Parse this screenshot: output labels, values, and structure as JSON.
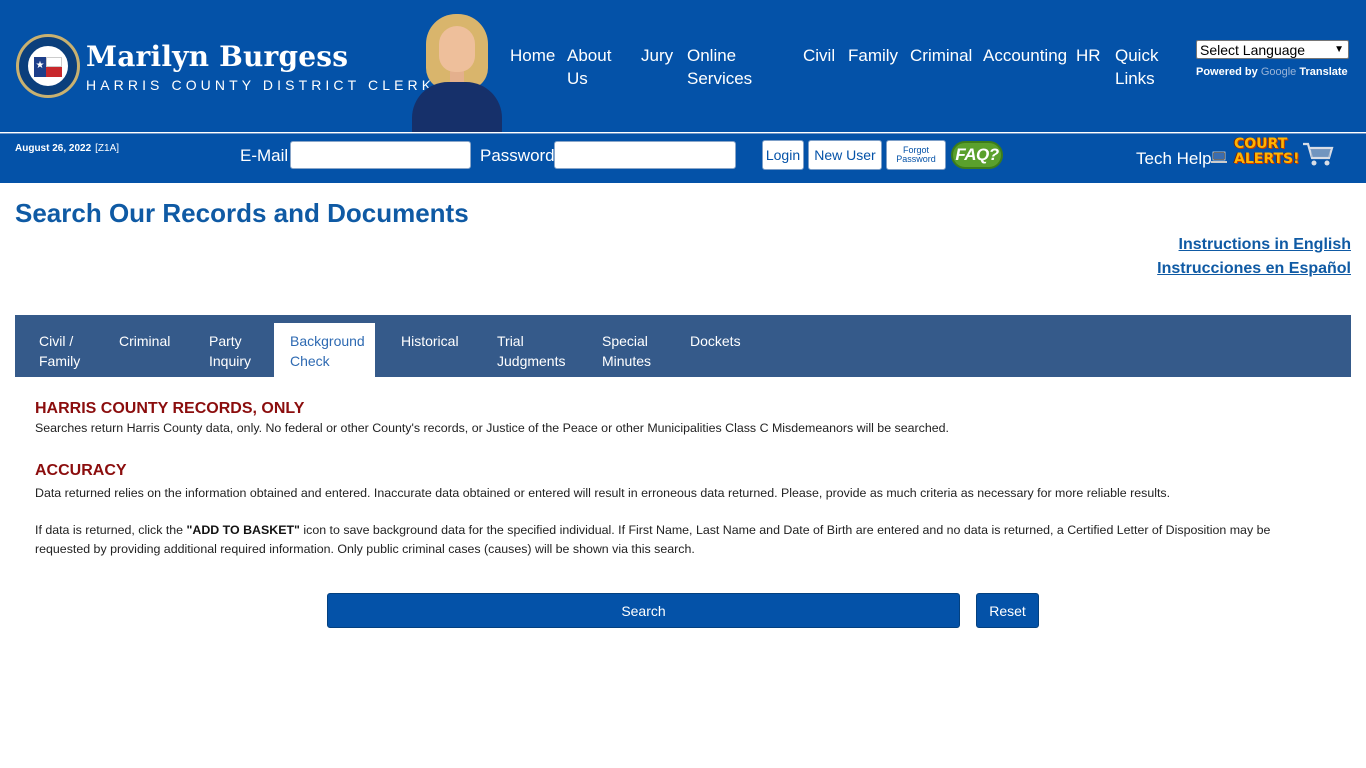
{
  "header": {
    "brand_name": "Marilyn Burgess",
    "brand_sub": "HARRIS COUNTY DISTRICT CLERK",
    "nav": [
      {
        "line1": "Home",
        "line2": ""
      },
      {
        "line1": "About",
        "line2": "Us"
      },
      {
        "line1": "Jury",
        "line2": ""
      },
      {
        "line1": "Online",
        "line2": "Services"
      },
      {
        "line1": "Civil",
        "line2": ""
      },
      {
        "line1": "Family",
        "line2": ""
      },
      {
        "line1": "Criminal",
        "line2": ""
      },
      {
        "line1": "Accounting",
        "line2": ""
      },
      {
        "line1": "HR",
        "line2": ""
      },
      {
        "line1": "Quick",
        "line2": "Links"
      }
    ],
    "language_select": "Select Language",
    "powered_by": "Powered by",
    "google": "Google",
    "translate": "Translate"
  },
  "login_bar": {
    "date": "August 26, 2022",
    "code": "[Z1A]",
    "email_label": "E-Mail",
    "email_value": "",
    "password_label": "Password",
    "password_value": "",
    "login_label": "Login",
    "new_user_label": "New User",
    "forgot_line1": "Forgot",
    "forgot_line2": "Password",
    "faq_label": "FAQ?",
    "tech_help": "Tech Help",
    "court_alerts_line1": "COURT",
    "court_alerts_line2": "ALERTS!"
  },
  "content": {
    "title": "Search Our Records and Documents",
    "instructions_en": "Instructions in English",
    "instructions_es": "Instrucciones en Español",
    "tabs": [
      {
        "line1": "Civil /",
        "line2": "Family"
      },
      {
        "line1": "Criminal",
        "line2": ""
      },
      {
        "line1": "Party",
        "line2": "Inquiry"
      },
      {
        "line1": "Background",
        "line2": "Check"
      },
      {
        "line1": "Historical",
        "line2": ""
      },
      {
        "line1": "Trial",
        "line2": "Judgments"
      },
      {
        "line1": "Special",
        "line2": "Minutes"
      },
      {
        "line1": "Dockets",
        "line2": ""
      }
    ],
    "active_tab": "Background Check",
    "notice1_head": "HARRIS COUNTY RECORDS, ONLY",
    "notice1_text": "Searches return Harris County data, only. No federal or other County's records, or Justice of the Peace or other Municipalities Class C Misdemeanors will be searched.",
    "notice2_head": "ACCURACY",
    "notice2_text": "Data returned relies on the information obtained and entered. Inaccurate data obtained or entered will result in erroneous data returned. Please, provide as much criteria as necessary for more reliable results.",
    "notice3_pre": "If data is returned, click the ",
    "notice3_bold": "\"ADD TO BASKET\"",
    "notice3_post": " icon to save background data for the specified individual. If First Name, Last Name and Date of Birth are entered and no data is returned, a Certified Letter of Disposition may be requested by providing additional required information. Only public criminal cases (causes) will be shown via this search.",
    "search_label": "Search",
    "reset_label": "Reset"
  },
  "colors": {
    "header_blue": "#0452a8",
    "tab_bar": "#355a8a",
    "title_blue": "#0f5aa4",
    "notice_red": "#8b0d0d"
  },
  "icons": [
    "district-clerk-seal-icon",
    "laptop-icon",
    "shopping-cart-icon",
    "faq-icon",
    "chevron-down-icon"
  ]
}
